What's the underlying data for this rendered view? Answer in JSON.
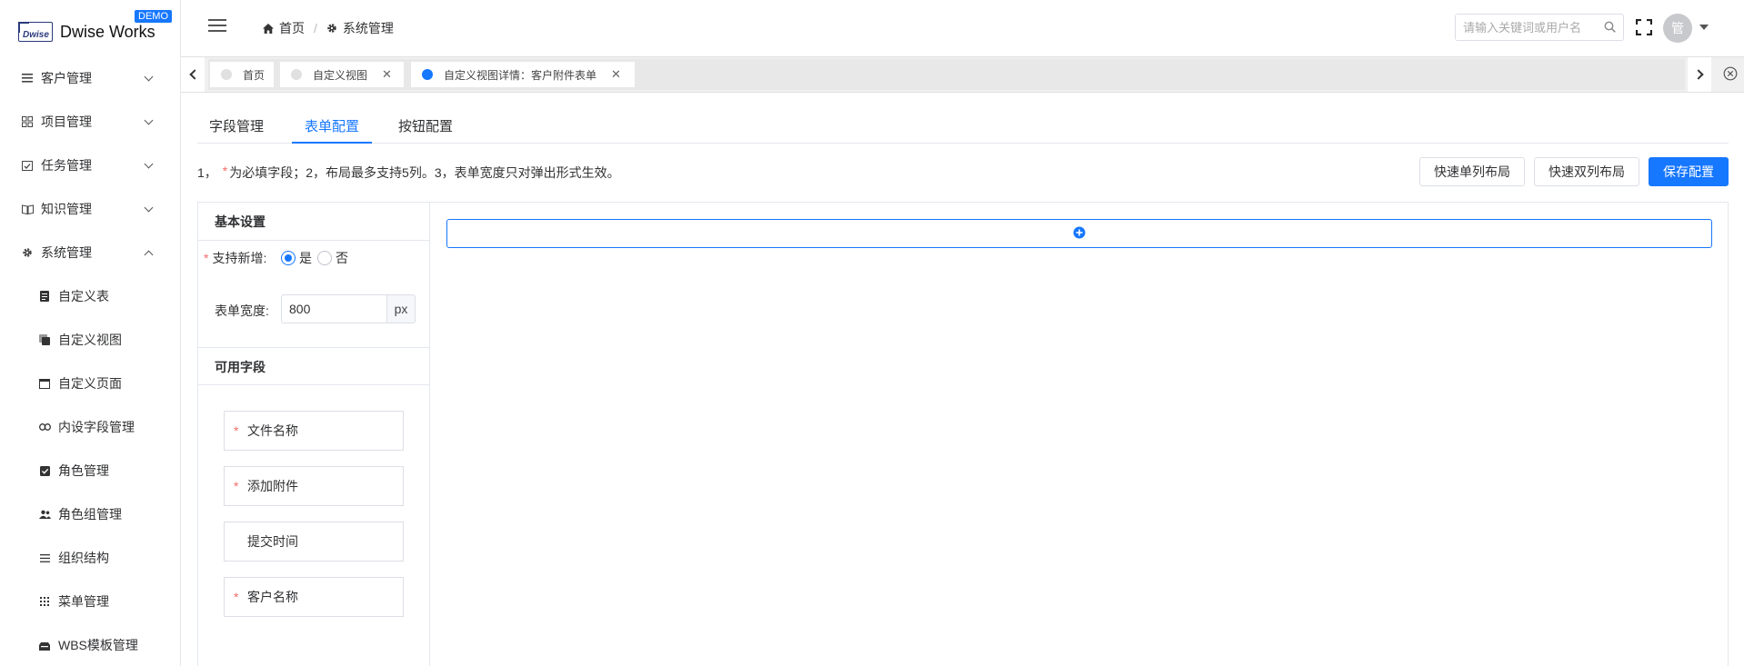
{
  "logo": {
    "mark": "Dwise",
    "text": "Dwise Works",
    "badge": "DEMO"
  },
  "sidebar": {
    "menus": [
      {
        "label": "客户管理",
        "icon": "list-icon",
        "expanded": false
      },
      {
        "label": "项目管理",
        "icon": "grid-icon",
        "expanded": false
      },
      {
        "label": "任务管理",
        "icon": "calendar-check-icon",
        "expanded": false
      },
      {
        "label": "知识管理",
        "icon": "book-icon",
        "expanded": false
      },
      {
        "label": "系统管理",
        "icon": "gear-icon",
        "expanded": true
      }
    ],
    "subitems": [
      {
        "label": "自定义表",
        "icon": "doc-icon"
      },
      {
        "label": "自定义视图",
        "icon": "copy-icon"
      },
      {
        "label": "自定义页面",
        "icon": "window-icon"
      },
      {
        "label": "内设字段管理",
        "icon": "link-icon"
      },
      {
        "label": "角色管理",
        "icon": "checkbox-icon"
      },
      {
        "label": "角色组管理",
        "icon": "users-icon"
      },
      {
        "label": "组织结构",
        "icon": "lines-icon"
      },
      {
        "label": "菜单管理",
        "icon": "dots-grid-icon"
      },
      {
        "label": "WBS模板管理",
        "icon": "stack-icon"
      }
    ]
  },
  "header": {
    "breadcrumb": [
      {
        "label": "首页",
        "icon": "home-icon"
      },
      {
        "label": "系统管理",
        "icon": "gear-icon"
      }
    ],
    "search_placeholder": "请输入关键词或用户名",
    "avatar_text": "管"
  },
  "tabs": [
    {
      "label": "首页",
      "active": false,
      "closable": false
    },
    {
      "label": "自定义视图",
      "active": false,
      "closable": true
    },
    {
      "label": "自定义视图详情：客户附件表单",
      "active": true,
      "closable": true
    }
  ],
  "subtabs": [
    "字段管理",
    "表单配置",
    "按钮配置"
  ],
  "active_subtab": "表单配置",
  "notice": {
    "part1": "1，",
    "star": "*",
    "part2": "为必填字段；2，布局最多支持5列。3，表单宽度只对弹出形式生效。"
  },
  "buttons": {
    "single": "快速单列布局",
    "double": "快速双列布局",
    "save": "保存配置"
  },
  "basic": {
    "title": "基本设置",
    "support_add_label": "支持新增:",
    "yes": "是",
    "no": "否",
    "selected": "是",
    "width_label": "表单宽度:",
    "width_value": "800",
    "width_unit": "px"
  },
  "fields": {
    "title": "可用字段",
    "items": [
      {
        "label": "文件名称",
        "required": true
      },
      {
        "label": "添加附件",
        "required": true
      },
      {
        "label": "提交时间",
        "required": false
      },
      {
        "label": "客户名称",
        "required": true
      }
    ]
  },
  "colors": {
    "primary": "#1677ff",
    "required": "#f56c6c"
  }
}
